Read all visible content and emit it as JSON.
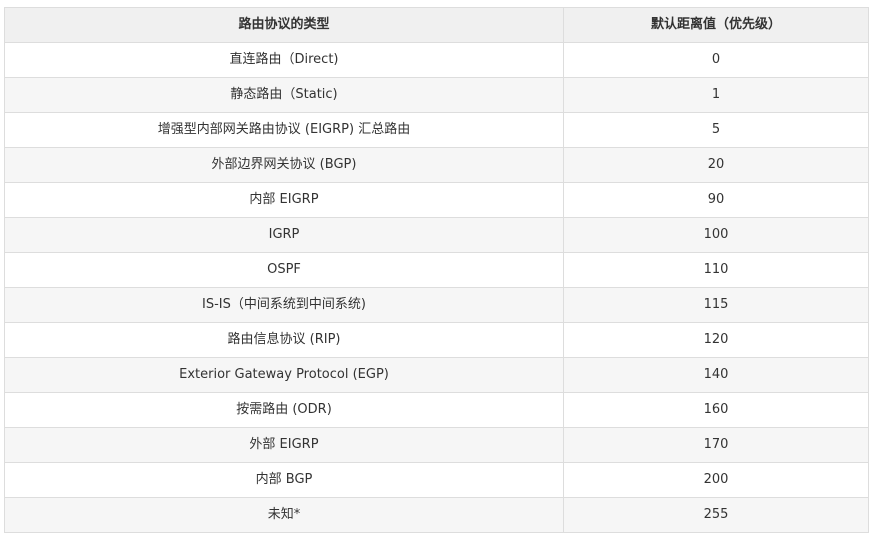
{
  "table": {
    "headers": [
      "路由协议的类型",
      "默认距离值（优先级）"
    ],
    "rows": [
      [
        "直连路由（Direct)",
        "0"
      ],
      [
        "静态路由（Static)",
        "1"
      ],
      [
        "增强型内部网关路由协议 (EIGRP) 汇总路由",
        "5"
      ],
      [
        "外部边界网关协议 (BGP)",
        "20"
      ],
      [
        "内部 EIGRP",
        "90"
      ],
      [
        "IGRP",
        "100"
      ],
      [
        "OSPF",
        "110"
      ],
      [
        "IS-IS（中间系统到中间系统)",
        "115"
      ],
      [
        "路由信息协议 (RIP)",
        "120"
      ],
      [
        "Exterior Gateway Protocol (EGP)",
        "140"
      ],
      [
        "按需路由 (ODR)",
        "160"
      ],
      [
        "外部 EIGRP",
        "170"
      ],
      [
        "内部 BGP",
        "200"
      ],
      [
        "未知*",
        "255"
      ]
    ]
  }
}
